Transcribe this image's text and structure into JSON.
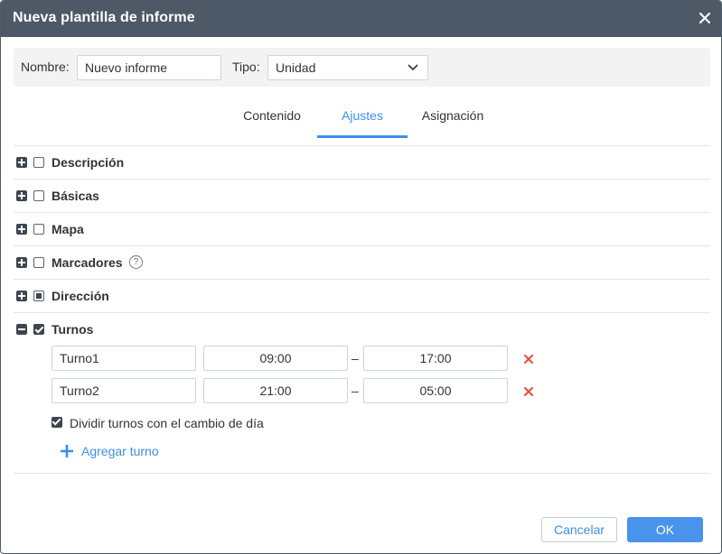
{
  "window": {
    "title": "Nueva plantilla de informe"
  },
  "header": {
    "name_label": "Nombre:",
    "name_value": "Nuevo informe",
    "type_label": "Tipo:",
    "type_value": "Unidad"
  },
  "tabs": [
    {
      "label": "Contenido",
      "active": false
    },
    {
      "label": "Ajustes",
      "active": true
    },
    {
      "label": "Asignación",
      "active": false
    }
  ],
  "sections": [
    {
      "label": "Descripción",
      "expanded": false,
      "checked": "none"
    },
    {
      "label": "Básicas",
      "expanded": false,
      "checked": "none"
    },
    {
      "label": "Mapa",
      "expanded": false,
      "checked": "none"
    },
    {
      "label": "Marcadores",
      "expanded": false,
      "checked": "none",
      "help": "?"
    },
    {
      "label": "Dirección",
      "expanded": false,
      "checked": "partial"
    },
    {
      "label": "Turnos",
      "expanded": true,
      "checked": "full"
    }
  ],
  "shifts": [
    {
      "name": "Turno1",
      "from": "09:00",
      "to": "17:00"
    },
    {
      "name": "Turno2",
      "from": "21:00",
      "to": "05:00"
    }
  ],
  "shift_separator": "–",
  "split_shifts_label": "Dividir turnos con el cambio de día",
  "add_shift_label": "Agregar turno",
  "footer": {
    "cancel_label": "Cancelar",
    "ok_label": "OK"
  },
  "colors": {
    "accent": "#3e8ee8",
    "titlebar": "#4d5966",
    "delete": "#e84a3c"
  }
}
